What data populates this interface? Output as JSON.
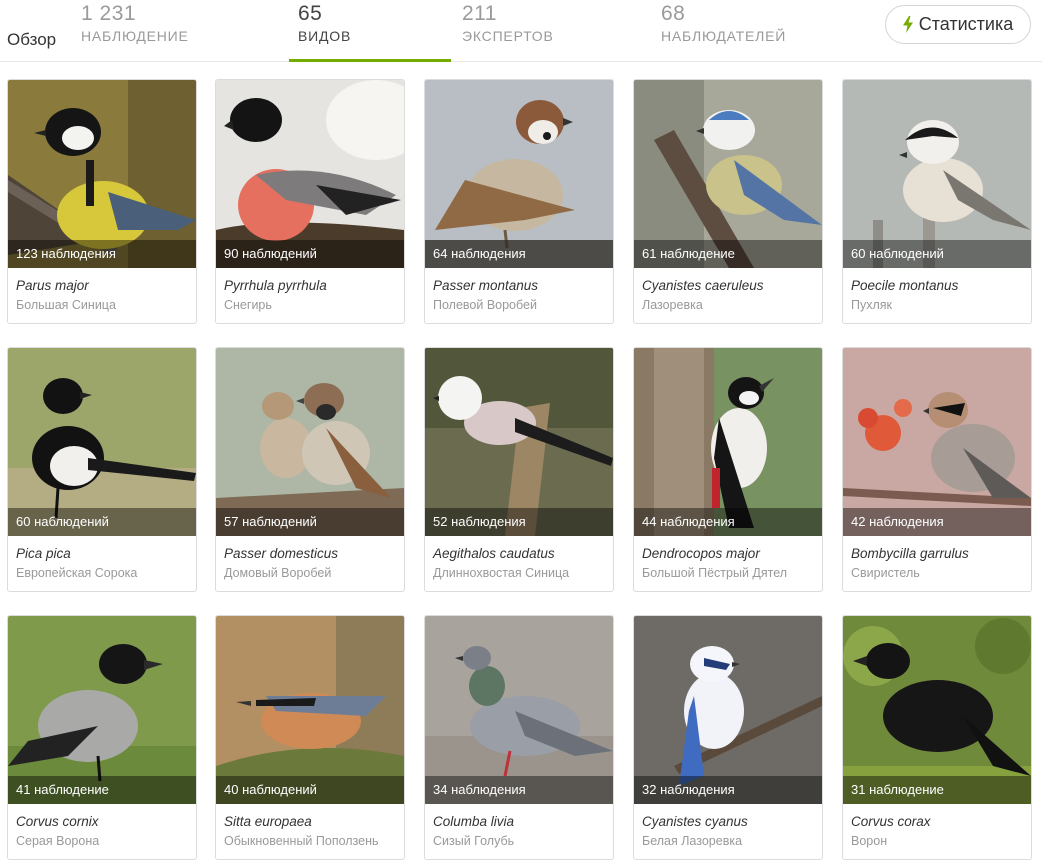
{
  "header": {
    "overview_label": "Обзор",
    "stats": [
      {
        "value": "1 231",
        "label": "НАБЛЮДЕНИЕ",
        "active": false
      },
      {
        "value": "65",
        "label": "ВИДОВ",
        "active": true
      },
      {
        "value": "211",
        "label": "ЭКСПЕРТОВ",
        "active": false
      },
      {
        "value": "68",
        "label": "НАБЛЮДАТЕЛЕЙ",
        "active": false
      }
    ],
    "stats_button_label": "Статистика",
    "accent_color": "#74ac00"
  },
  "species": [
    {
      "count": "123 наблюдения",
      "scientific": "Parus major",
      "common": "Большая Синица",
      "icon": "great-tit"
    },
    {
      "count": "90 наблюдений",
      "scientific": "Pyrrhula pyrrhula",
      "common": "Снегирь",
      "icon": "bullfinch"
    },
    {
      "count": "64 наблюдения",
      "scientific": "Passer montanus",
      "common": "Полевой Воробей",
      "icon": "tree-sparrow"
    },
    {
      "count": "61 наблюдение",
      "scientific": "Cyanistes caeruleus",
      "common": "Лазоревка",
      "icon": "blue-tit"
    },
    {
      "count": "60 наблюдений",
      "scientific": "Poecile montanus",
      "common": "Пухляк",
      "icon": "willow-tit"
    },
    {
      "count": "60 наблюдений",
      "scientific": "Pica pica",
      "common": "Европейская Сорока",
      "icon": "magpie"
    },
    {
      "count": "57 наблюдений",
      "scientific": "Passer domesticus",
      "common": "Домовый Воробей",
      "icon": "house-sparrow"
    },
    {
      "count": "52 наблюдения",
      "scientific": "Aegithalos caudatus",
      "common": "Длиннохвостая Синица",
      "icon": "long-tailed-tit"
    },
    {
      "count": "44 наблюдения",
      "scientific": "Dendrocopos major",
      "common": "Большой Пёстрый Дятел",
      "icon": "woodpecker"
    },
    {
      "count": "42 наблюдения",
      "scientific": "Bombycilla garrulus",
      "common": "Свиристель",
      "icon": "waxwing"
    },
    {
      "count": "41 наблюдение",
      "scientific": "Corvus cornix",
      "common": "Серая Ворона",
      "icon": "hooded-crow"
    },
    {
      "count": "40 наблюдений",
      "scientific": "Sitta europaea",
      "common": "Обыкновенный Поползень",
      "icon": "nuthatch"
    },
    {
      "count": "34 наблюдения",
      "scientific": "Columba livia",
      "common": "Сизый Голубь",
      "icon": "pigeon"
    },
    {
      "count": "32 наблюдения",
      "scientific": "Cyanistes cyanus",
      "common": "Белая Лазоревка",
      "icon": "azure-tit"
    },
    {
      "count": "31 наблюдение",
      "scientific": "Corvus corax",
      "common": "Ворон",
      "icon": "raven"
    }
  ]
}
